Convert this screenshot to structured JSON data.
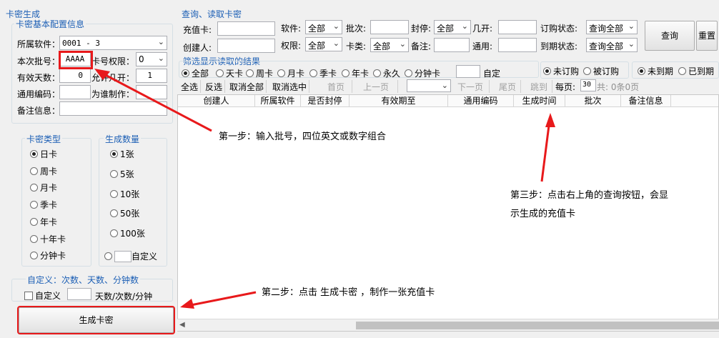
{
  "left": {
    "title": "卡密生成",
    "basic_group": "卡密基本配置信息",
    "software_label": "所属软件：",
    "software_value": "0001 - 3",
    "batch_label": "本次批号：",
    "batch_value": "AAAA",
    "card_perm_label": "卡号权限：",
    "card_perm_value": "0",
    "valid_days_label": "有效天数：",
    "valid_days_value": "0",
    "open_label": "允许几开：",
    "open_value": "1",
    "common_code_label": "通用编码：",
    "maker_label": "为谁制作：",
    "remark_label": "备注信息：",
    "type_group": "卡密类型",
    "types": [
      "日卡",
      "周卡",
      "月卡",
      "季卡",
      "年卡",
      "十年卡",
      "分钟卡"
    ],
    "count_group": "生成数量",
    "counts": [
      "1张",
      "5张",
      "10张",
      "50张",
      "100张"
    ],
    "custom_count_label": "自定义",
    "custom_group": "自定义：次数、天数、分钟数",
    "custom_check_label": "自定义",
    "custom_unit_label": "天数/次数/分钟",
    "generate_button": "生成卡密"
  },
  "right": {
    "title": "查询、读取卡密",
    "card_label": "充值卡:",
    "software_label": "软件:",
    "software_value": "全部",
    "batch_label": "批次:",
    "seal_label": "封停:",
    "seal_value": "全部",
    "open_label": "几开:",
    "order_status_label": "订购状态:",
    "order_status_value": "查询全部",
    "creator_label": "创建人:",
    "perm_label": "权限:",
    "perm_value": "全部",
    "cardtype_label": "卡类:",
    "cardtype_value": "全部",
    "remark_label": "备注:",
    "common_label": "通用:",
    "expire_status_label": "到期状态:",
    "expire_status_value": "查询全部",
    "query_button": "查询",
    "reset_button": "重置",
    "filter_title": "筛选显示读取的结果",
    "filter_options": [
      "全部",
      "天卡",
      "周卡",
      "月卡",
      "季卡",
      "年卡",
      "永久",
      "分钟卡"
    ],
    "filter_custom_label": "自定",
    "order_options": [
      "未订购",
      "被订购"
    ],
    "expire_options": [
      "未到期",
      "已到期"
    ],
    "toolbar": {
      "select_all": "全选",
      "invert": "反选",
      "deselect_all": "取消全部",
      "cancel_selected": "取消选中",
      "first": "首页",
      "prev": "上一页",
      "next": "下一页",
      "last": "尾页",
      "jump": "跳到",
      "per_page_label": "每页:",
      "per_page_value": "30",
      "total": "共: 0条0页"
    },
    "columns": [
      "创建人",
      "所属软件",
      "是否封停",
      "有效期至",
      "通用编码",
      "生成时间",
      "批次",
      "备注信息"
    ]
  },
  "annotations": {
    "step1": "第一步：输入批号，四位英文或数字组合",
    "step2": "第二步：点击 生成卡密 ，制作一张充值卡",
    "step3_line1": "第三步：点击右上角的查询按钮，会显",
    "step3_line2": "示生成的充值卡"
  },
  "colors": {
    "group_title": "#1c5fb5",
    "annotation_arrow": "#e8191b"
  },
  "icons": [
    "chevron-down-icon",
    "radio-icon",
    "checkbox-icon",
    "red-arrow-icon"
  ]
}
